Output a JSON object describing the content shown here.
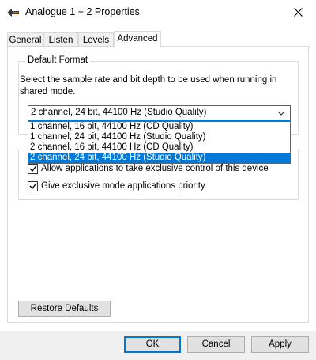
{
  "window": {
    "title": "Analogue 1 + 2 Properties",
    "app_icon": "speaker-arrow-icon",
    "close_icon": "close-icon"
  },
  "tabs": [
    {
      "label": "General",
      "active": false
    },
    {
      "label": "Listen",
      "active": false
    },
    {
      "label": "Levels",
      "active": false
    },
    {
      "label": "Advanced",
      "active": true
    }
  ],
  "default_format": {
    "legend": "Default Format",
    "description": "Select the sample rate and bit depth to be used when running in shared mode.",
    "selected": "2 channel, 24 bit, 44100 Hz (Studio Quality)",
    "options": [
      "1 channel, 16 bit, 44100 Hz (CD Quality)",
      "1 channel, 24 bit, 44100 Hz (Studio Quality)",
      "2 channel, 16 bit, 44100 Hz (CD Quality)",
      "2 channel, 24 bit, 44100 Hz (Studio Quality)"
    ],
    "highlighted_index": 3
  },
  "exclusive_mode": {
    "legend_visible": "E",
    "allow_exclusive": {
      "label": "Allow applications to take exclusive control of this device",
      "checked": true
    },
    "exclusive_priority": {
      "label": "Give exclusive mode applications priority",
      "checked": true
    }
  },
  "buttons": {
    "restore_defaults": "Restore Defaults",
    "ok": "OK",
    "cancel": "Cancel",
    "apply": "Apply"
  },
  "colors": {
    "accent": "#0078d7",
    "button_face": "#e1e1e1",
    "dialog_bg": "#f0f0f0"
  }
}
